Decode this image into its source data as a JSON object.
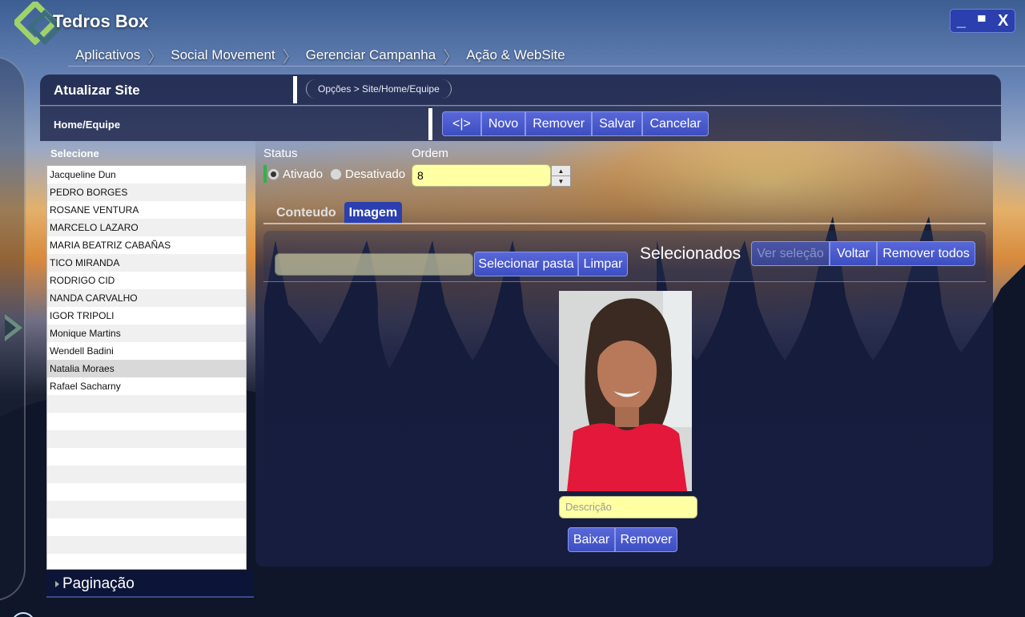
{
  "app": {
    "title": "Tedros Box"
  },
  "window_controls": {
    "minimize": "_",
    "maximize": "▀",
    "close": "X"
  },
  "breadcrumb": [
    "Aplicativos",
    "Social Movement",
    "Gerenciar Campanha",
    "Ação & WebSite"
  ],
  "header": {
    "title": "Atualizar Site",
    "options_path": "Opções > Site/Home/Equipe",
    "subtitle": "Home/Equipe"
  },
  "toolbar": {
    "toggle_label": "<|>",
    "new_label": "Novo",
    "remove_label": "Remover",
    "save_label": "Salvar",
    "cancel_label": "Cancelar"
  },
  "list": {
    "label": "Selecione",
    "items": [
      "Jacqueline Dun",
      "PEDRO BORGES",
      "ROSANE VENTURA",
      "MARCELO LAZARO",
      "MARIA BEATRIZ CABAÑAS",
      "TICO MIRANDA",
      "RODRIGO CID",
      "NANDA CARVALHO",
      "IGOR TRIPOLI",
      "Monique Martins",
      "Wendell Badini",
      "Natalia Moraes",
      "Rafael Sacharny"
    ],
    "selected": "Natalia Moraes",
    "pagination_label": "Paginação"
  },
  "form": {
    "status_label": "Status",
    "status_options": [
      "Ativado",
      "Desativado"
    ],
    "status_selected": "Ativado",
    "order_label": "Ordem",
    "order_value": "8",
    "spinner_up": "▲",
    "spinner_down": "▼"
  },
  "tabs": [
    "Conteudo",
    "Imagem"
  ],
  "active_tab": "Imagem",
  "image_panel": {
    "select_folder_label": "Selecionar pasta",
    "clear_label": "Limpar",
    "selected_title": "Selecionados",
    "view_selection_label": "Ver seleção",
    "back_label": "Voltar",
    "remove_all_label": "Remover todos",
    "description_placeholder": "Descrição",
    "download_label": "Baixar",
    "remove_label": "Remover"
  },
  "colors": {
    "accent_button": "#3d4ec2",
    "active_tab": "#2b3fae",
    "input_yellow": "#ffffa3",
    "panel_dark": "#1e264a",
    "status_green": "#2db34a"
  }
}
